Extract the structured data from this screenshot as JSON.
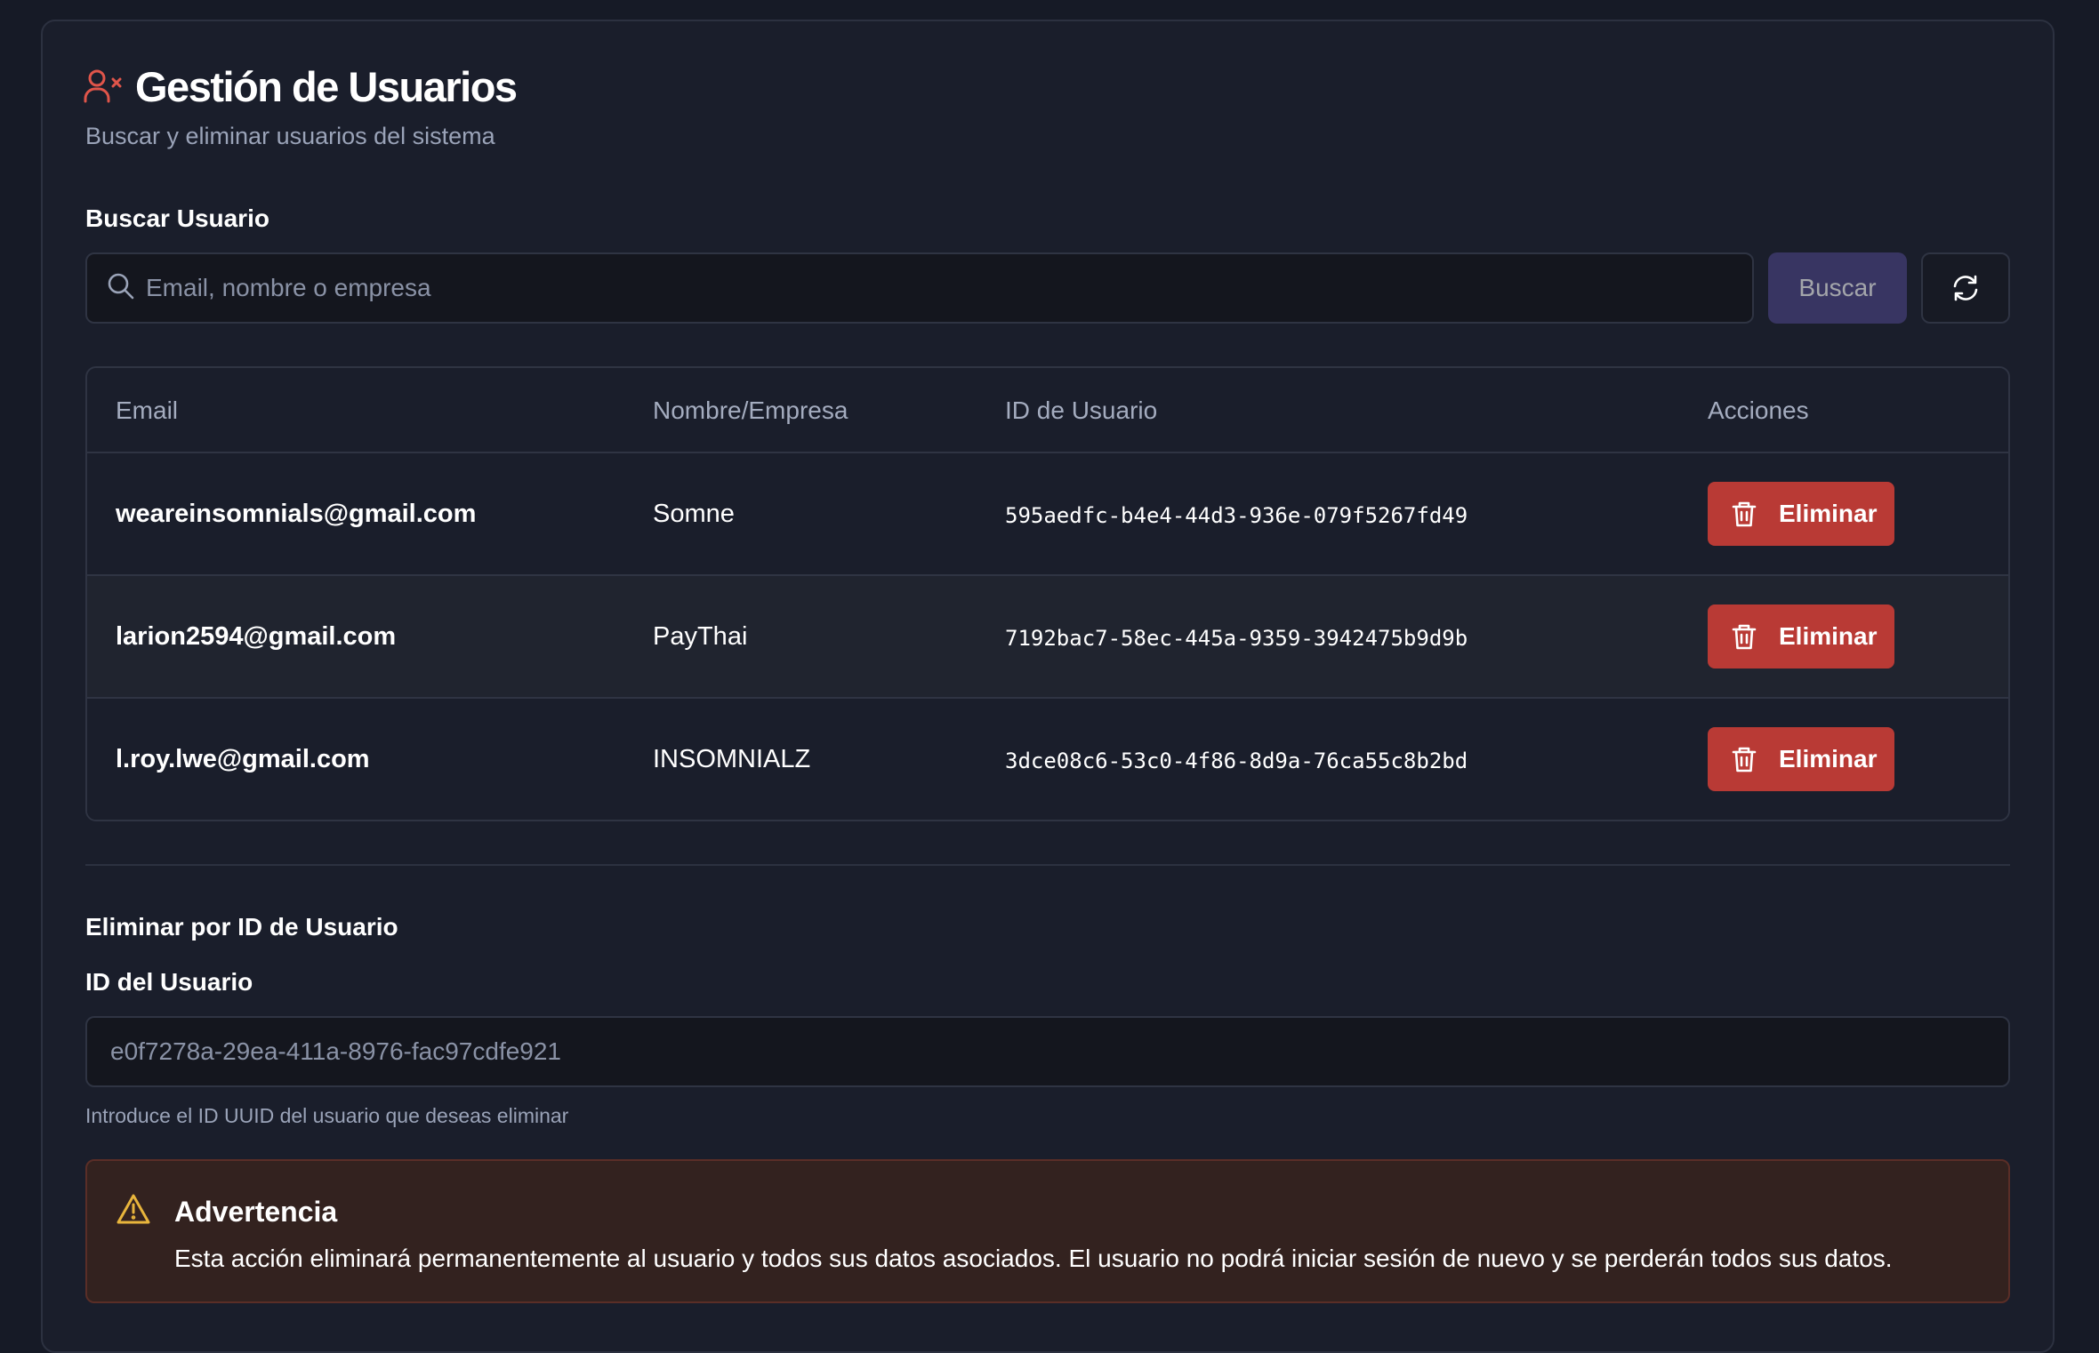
{
  "header": {
    "title": "Gestión de Usuarios",
    "subtitle": "Buscar y eliminar usuarios del sistema",
    "icon": "user-x-icon",
    "accent_color": "#e0554a"
  },
  "search": {
    "label": "Buscar Usuario",
    "placeholder": "Email, nombre o empresa",
    "value": "",
    "button_label": "Buscar",
    "refresh_icon": "refresh-icon"
  },
  "table": {
    "columns": [
      "Email",
      "Nombre/Empresa",
      "ID de Usuario",
      "Acciones"
    ],
    "rows": [
      {
        "email": "weareinsomnials@gmail.com",
        "name": "Somne",
        "id": "595aedfc-b4e4-44d3-936e-079f5267fd49",
        "action_label": "Eliminar"
      },
      {
        "email": "larion2594@gmail.com",
        "name": "PayThai",
        "id": "7192bac7-58ec-445a-9359-3942475b9d9b",
        "action_label": "Eliminar"
      },
      {
        "email": "l.roy.lwe@gmail.com",
        "name": "INSOMNIALZ",
        "id": "3dce08c6-53c0-4f86-8d9a-76ca55c8b2bd",
        "action_label": "Eliminar"
      }
    ],
    "delete_color": "#b93a35"
  },
  "delete_by_id": {
    "section_title": "Eliminar por ID de Usuario",
    "field_label": "ID del Usuario",
    "placeholder": "e0f7278a-29ea-411a-8976-fac97cdfe921",
    "value": "",
    "helper": "Introduce el ID UUID del usuario que deseas eliminar"
  },
  "warning": {
    "title": "Advertencia",
    "text": "Esta acción eliminará permanentemente al usuario y todos sus datos asociados. El usuario no podrá iniciar sesión de nuevo y se perderán todos sus datos.",
    "icon": "alert-triangle-icon",
    "color": "#e8b53c"
  }
}
